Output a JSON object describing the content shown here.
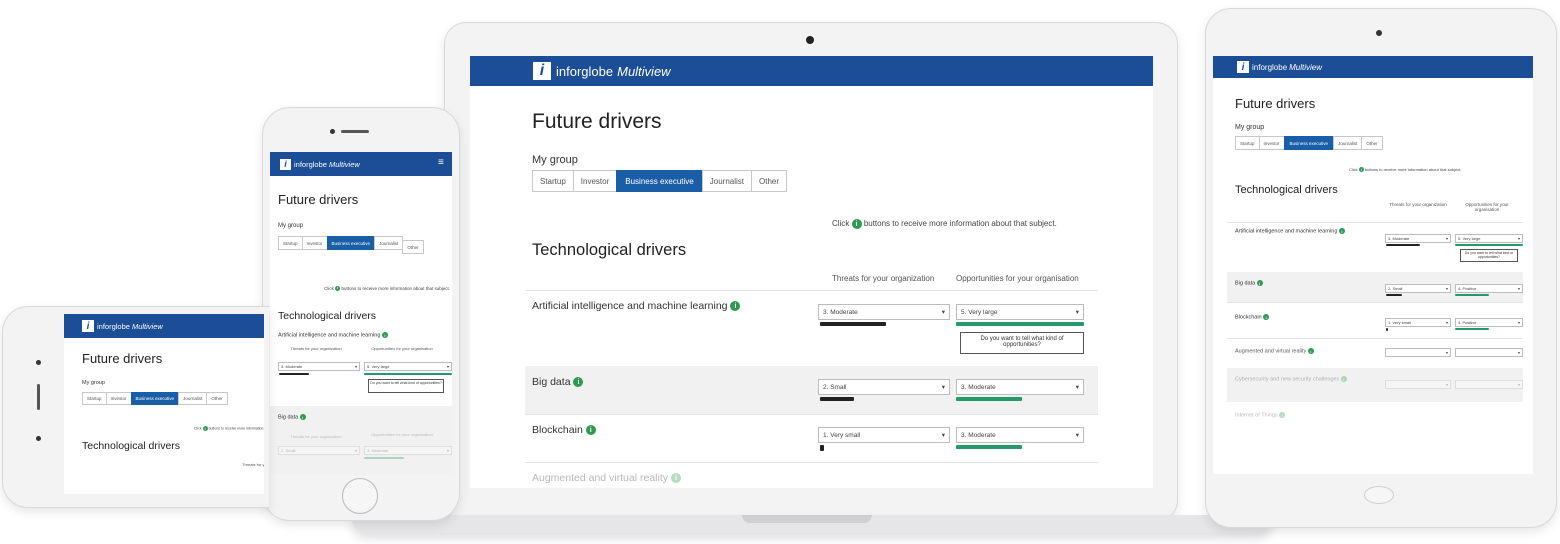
{
  "brand": {
    "logo_letter": "i",
    "name": "inforglobe",
    "product": "Multiview"
  },
  "colors": {
    "brand_blue": "#1b4e96",
    "active_tab": "#1b5ea8",
    "info_green": "#2d9a4f",
    "meter_green": "#249a6a",
    "meter_dark": "#222222"
  },
  "page": {
    "title": "Future drivers",
    "group_label": "My group",
    "groups": [
      "Startup",
      "Investor",
      "Business executive",
      "Journalist",
      "Other"
    ],
    "active_group": "Business executive",
    "hint_prefix": "Click",
    "hint_suffix": "buttons to receive more information about that subject.",
    "section_title": "Technological drivers",
    "col_threats": "Threats for your organization",
    "col_opportunities": "Opportunities for your organisation",
    "info_icon": "info-circle-icon",
    "tooltip": "Do you want to tell what kind of opportunities?",
    "rows": [
      {
        "label": "Artificial intelligence and machine learning",
        "threat": "3. Moderate",
        "opportunity": "5. Very large",
        "threat_level": 0.6,
        "opportunity_level": 1.0
      },
      {
        "label": "Big data",
        "threat": "2. Small",
        "opportunity": "3. Moderate",
        "threat_level": 0.4,
        "opportunity_level": 0.6
      },
      {
        "label": "Blockchain",
        "threat": "1. Very small",
        "opportunity": "3. Moderate",
        "threat_level": 0.05,
        "opportunity_level": 0.6
      },
      {
        "label": "Augmented and virtual reality",
        "threat": "",
        "opportunity": ""
      },
      {
        "label": "Cybersecurity and new security challenges",
        "threat": "",
        "opportunity": ""
      },
      {
        "label": "Internet of Things",
        "threat": "",
        "opportunity": ""
      }
    ]
  },
  "tablet": {
    "row_values": [
      {
        "threat": "3. Moderate",
        "opportunity": "5. Very large"
      },
      {
        "threat": "2. Small",
        "opportunity": "4. Positive"
      },
      {
        "threat": "1. Very small",
        "opportunity": "4. Positive"
      }
    ]
  }
}
